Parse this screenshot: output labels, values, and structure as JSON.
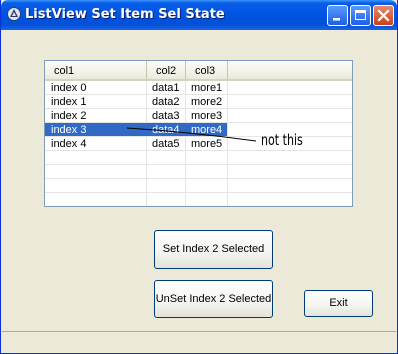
{
  "window": {
    "title": "ListView Set Item Sel State"
  },
  "listview": {
    "columns": [
      "col1",
      "col2",
      "col3"
    ],
    "rows": [
      {
        "col1": "index 0",
        "col2": "data1",
        "col3": "more1",
        "selected": false
      },
      {
        "col1": "index 1",
        "col2": "data2",
        "col3": "more2",
        "selected": false
      },
      {
        "col1": "index 2",
        "col2": "data3",
        "col3": "more3",
        "selected": false
      },
      {
        "col1": "index 3",
        "col2": "data4",
        "col3": "more4",
        "selected": true
      },
      {
        "col1": "index 4",
        "col2": "data5",
        "col3": "more5",
        "selected": false
      }
    ]
  },
  "buttons": {
    "set_label": "Set Index 2 Selected",
    "unset_label": "UnSet Index 2 Selected",
    "exit_label": "Exit"
  },
  "annotation": {
    "text": "not this"
  },
  "colors": {
    "titlebar": "#0054e3",
    "selection": "#316ac5",
    "face": "#ece9d8"
  }
}
